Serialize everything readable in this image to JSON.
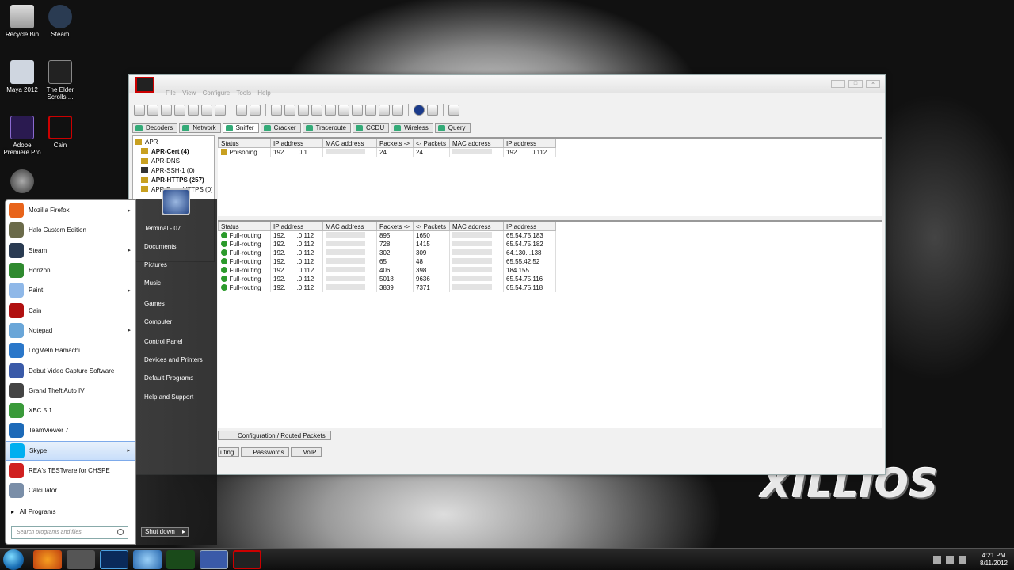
{
  "desktop_icons": [
    {
      "label": "Recycle Bin",
      "icon": "recycle-bin-icon"
    },
    {
      "label": "Steam",
      "icon": "steam-icon"
    },
    {
      "label": "Maya 2012",
      "icon": "maya-icon"
    },
    {
      "label": "The Elder Scrolls ...",
      "icon": "elder-scrolls-icon"
    },
    {
      "label": "Adobe Premiere Pro",
      "icon": "premiere-icon"
    },
    {
      "label": "Cain",
      "icon": "cain-icon"
    }
  ],
  "wallpaper_text": "XILLIOS",
  "cain": {
    "menu": [
      "File",
      "View",
      "Configure",
      "Tools",
      "Help"
    ],
    "tabs": [
      "Decoders",
      "Network",
      "Sniffer",
      "Cracker",
      "Traceroute",
      "CCDU",
      "Wireless",
      "Query"
    ],
    "tree": [
      {
        "label": "APR",
        "bold": false
      },
      {
        "label": "APR-Cert (4)",
        "bold": true
      },
      {
        "label": "APR-DNS",
        "bold": false
      },
      {
        "label": "APR-SSH-1 (0)",
        "bold": false
      },
      {
        "label": "APR-HTTPS (257)",
        "bold": true
      },
      {
        "label": "APR-ProxyHTTPS (0)",
        "bold": false
      }
    ],
    "columns": [
      "Status",
      "IP address",
      "MAC address",
      "Packets ->",
      "<- Packets",
      "MAC address",
      "IP address"
    ],
    "top_rows": [
      {
        "status": "Poisoning",
        "ip1": "192.",
        "ip1b": ".0.1",
        "p_out": "24",
        "p_in": "24",
        "ip2": "192.",
        "ip2b": ".0.112"
      }
    ],
    "bottom_rows": [
      {
        "status": "Full-routing",
        "ip1": "192.",
        "ip1b": ".0.112",
        "p_out": "895",
        "p_in": "1650",
        "ip2": "65.54.75.183"
      },
      {
        "status": "Full-routing",
        "ip1": "192.",
        "ip1b": ".0.112",
        "p_out": "728",
        "p_in": "1415",
        "ip2": "65.54.75.182"
      },
      {
        "status": "Full-routing",
        "ip1": "192.",
        "ip1b": ".0.112",
        "p_out": "302",
        "p_in": "309",
        "ip2": "64.130.   .138"
      },
      {
        "status": "Full-routing",
        "ip1": "192.",
        "ip1b": ".0.112",
        "p_out": "65",
        "p_in": "48",
        "ip2": "65.55.42.52"
      },
      {
        "status": "Full-routing",
        "ip1": "192.",
        "ip1b": ".0.112",
        "p_out": "406",
        "p_in": "398",
        "ip2": "184.155."
      },
      {
        "status": "Full-routing",
        "ip1": "192.",
        "ip1b": ".0.112",
        "p_out": "5018",
        "p_in": "9636",
        "ip2": "65.54.75.116"
      },
      {
        "status": "Full-routing",
        "ip1": "192.",
        "ip1b": ".0.112",
        "p_out": "3839",
        "p_in": "7371",
        "ip2": "65.54.75.118"
      }
    ],
    "config_tab": "Configuration / Routed Packets",
    "bottom_tabs": [
      "uting",
      "Passwords",
      "VoIP"
    ]
  },
  "start_menu": {
    "programs": [
      {
        "label": "Mozilla Firefox",
        "arrow": true,
        "color": "#e8641b"
      },
      {
        "label": "Halo Custom Edition",
        "arrow": false,
        "color": "#6b6b4a"
      },
      {
        "label": "Steam",
        "arrow": true,
        "color": "#2a3b52"
      },
      {
        "label": "Horizon",
        "arrow": false,
        "color": "#2f8a2f"
      },
      {
        "label": "Paint",
        "arrow": true,
        "color": "#8fb8e8"
      },
      {
        "label": "Cain",
        "arrow": false,
        "color": "#b01010"
      },
      {
        "label": "Notepad",
        "arrow": true,
        "color": "#6aa6d8"
      },
      {
        "label": "LogMeIn Hamachi",
        "arrow": false,
        "color": "#2a77c9"
      },
      {
        "label": "Debut Video Capture Software",
        "arrow": false,
        "color": "#3a5aa8"
      },
      {
        "label": "Grand Theft Auto IV",
        "arrow": false,
        "color": "#444"
      },
      {
        "label": "XBC 5.1",
        "arrow": false,
        "color": "#3a9a3a"
      },
      {
        "label": "TeamViewer 7",
        "arrow": false,
        "color": "#1d6ab8"
      },
      {
        "label": "Skype",
        "arrow": true,
        "color": "#00aff0"
      },
      {
        "label": "REA's TESTware for CHSPE",
        "arrow": false,
        "color": "#d02020"
      },
      {
        "label": "Calculator",
        "arrow": false,
        "color": "#7a8ea8"
      }
    ],
    "all_programs": "All Programs",
    "search_placeholder": "Search programs and files",
    "right_links": [
      "Terminal - 07",
      "Documents",
      "Pictures",
      "Music",
      "Games",
      "Computer",
      "Control Panel",
      "Devices and Printers",
      "Default Programs",
      "Help and Support"
    ],
    "shutdown": "Shut down"
  },
  "taskbar": {
    "time": "4:21 PM",
    "date": "8/11/2012"
  }
}
